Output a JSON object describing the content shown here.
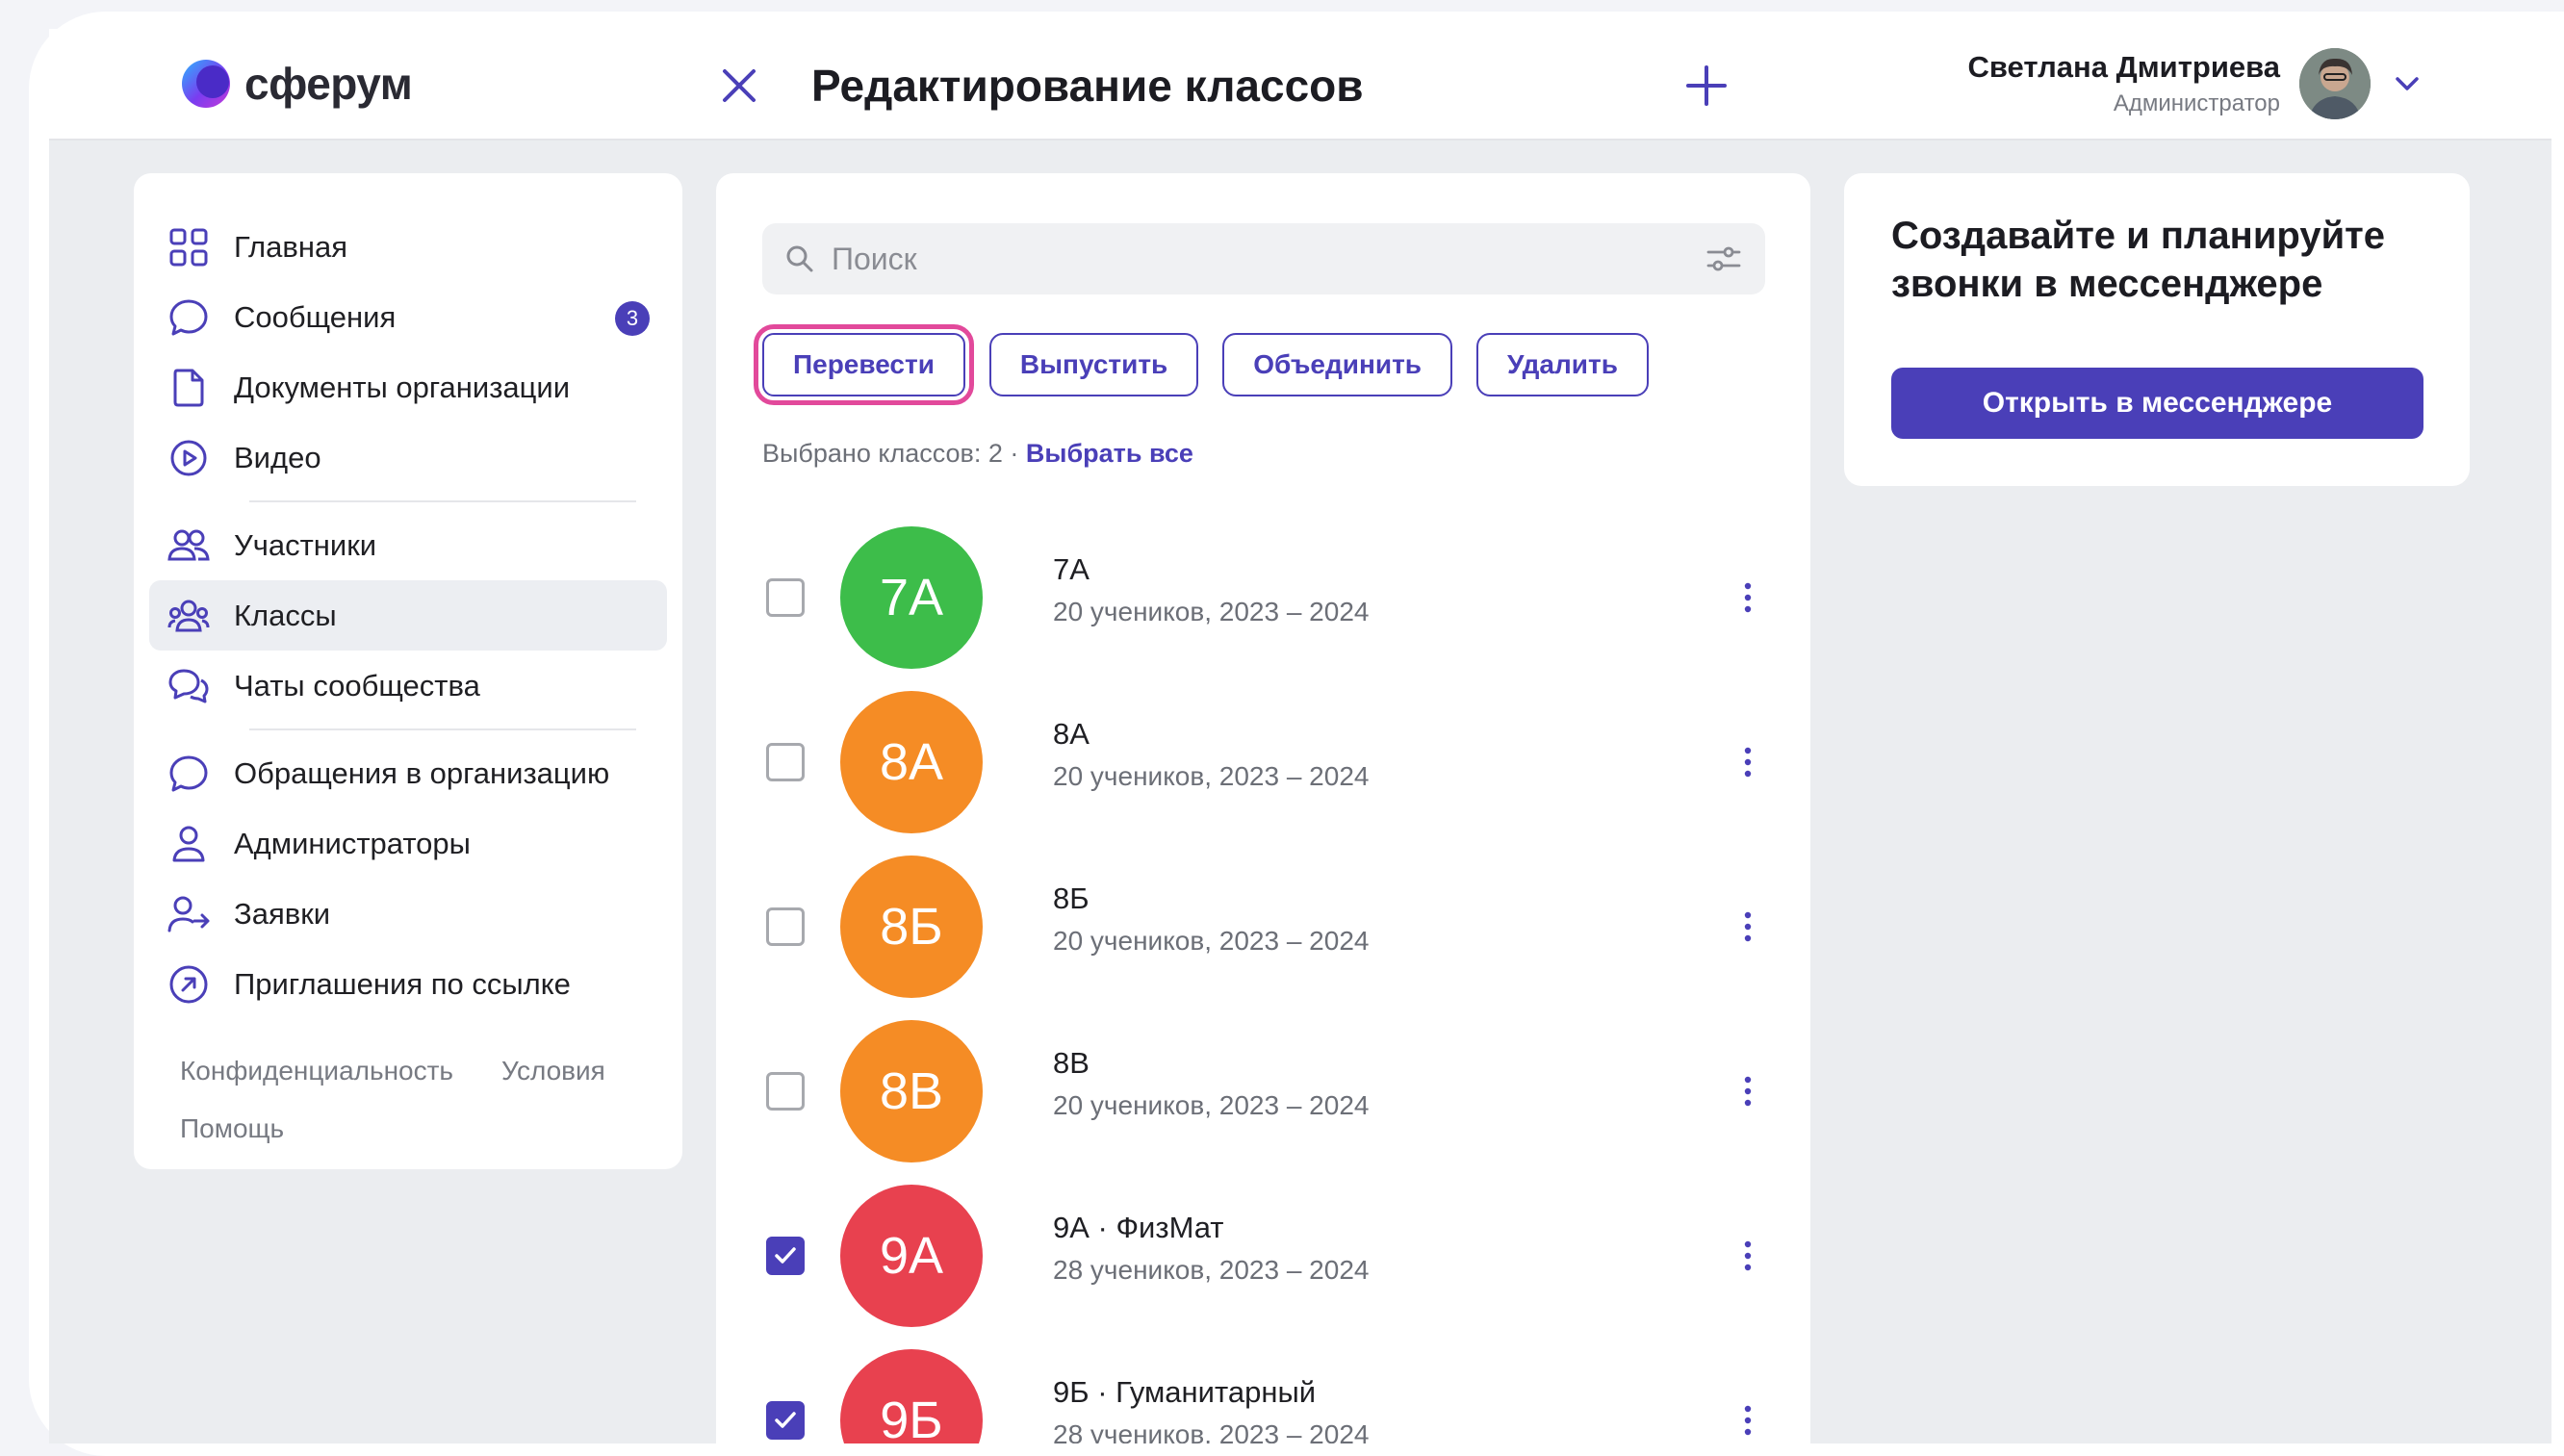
{
  "app": {
    "logo_text": "сферум",
    "title": "Редактирование классов"
  },
  "user": {
    "name": "Светлана Дмитриева",
    "role": "Администратор"
  },
  "sidebar": {
    "items": [
      {
        "label": "Главная",
        "icon": "grid-icon"
      },
      {
        "label": "Сообщения",
        "icon": "message-icon",
        "badge": "3"
      },
      {
        "label": "Документы организации",
        "icon": "document-icon"
      },
      {
        "label": "Видео",
        "icon": "play-icon"
      },
      {
        "label": "Участники",
        "icon": "users-icon"
      },
      {
        "label": "Классы",
        "icon": "classes-icon",
        "active": true
      },
      {
        "label": "Чаты сообщества",
        "icon": "chats-icon"
      },
      {
        "label": "Обращения в организацию",
        "icon": "message-icon"
      },
      {
        "label": "Администраторы",
        "icon": "person-icon"
      },
      {
        "label": "Заявки",
        "icon": "person-arrow-icon"
      },
      {
        "label": "Приглашения по ссылке",
        "icon": "link-arrow-icon"
      }
    ],
    "footer": {
      "privacy": "Конфиденциальность",
      "terms": "Условия",
      "help": "Помощь"
    }
  },
  "search": {
    "placeholder": "Поиск",
    "value": ""
  },
  "actions": {
    "transfer": "Перевести",
    "release": "Выпустить",
    "merge": "Объединить",
    "delete": "Удалить"
  },
  "selection": {
    "text": "Выбрано классов: 2 · ",
    "select_all": "Выбрать все"
  },
  "classes": [
    {
      "avatar": "7А",
      "name": "7А",
      "meta": "20 учеников, 2023 – 2024",
      "checked": false,
      "color": "#3dbd4a"
    },
    {
      "avatar": "8А",
      "name": "8А",
      "meta": "20 учеников, 2023 – 2024",
      "checked": false,
      "color": "#f58c25"
    },
    {
      "avatar": "8Б",
      "name": "8Б",
      "meta": "20 учеников, 2023 – 2024",
      "checked": false,
      "color": "#f58c25"
    },
    {
      "avatar": "8В",
      "name": "8В",
      "meta": "20 учеников, 2023 – 2024",
      "checked": false,
      "color": "#f58c25"
    },
    {
      "avatar": "9А",
      "name": "9А · ФизМат",
      "meta": "28 учеников, 2023 – 2024",
      "checked": true,
      "color": "#e8414f"
    },
    {
      "avatar": "9Б",
      "name": "9Б · Гуманитарный",
      "meta": "28 учеников, 2023 – 2024",
      "checked": true,
      "color": "#e8414f"
    }
  ],
  "promo": {
    "title": "Создавайте и планируйте звонки в мессенджере",
    "button": "Открыть в мессенджере"
  },
  "colors": {
    "accent": "#4a3fb8",
    "highlight": "#e2499b"
  }
}
